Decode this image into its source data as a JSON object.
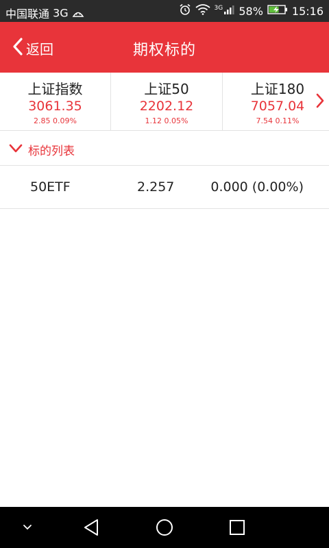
{
  "status_bar": {
    "carrier": "中国联通",
    "network": "3G",
    "signal_tag": "3G",
    "battery": "58%",
    "time": "15:16"
  },
  "header": {
    "back_label": "返回",
    "title": "期权标的"
  },
  "indices": [
    {
      "name": "上证指数",
      "price": "3061.35",
      "change": "2.85  0.09%"
    },
    {
      "name": "上证50",
      "price": "2202.12",
      "change": "1.12  0.05%"
    },
    {
      "name": "上证180",
      "price": "7057.04",
      "change": "7.54  0.11%"
    }
  ],
  "section": {
    "label": "标的列表"
  },
  "rows": [
    {
      "name": "50ETF",
      "price": "2.257",
      "change": "0.000 (0.00%)"
    }
  ],
  "colors": {
    "accent": "#e8343a",
    "status_bar": "#2b2b2b",
    "nav_bar": "#000000"
  },
  "icons": {
    "back": "chevron-left-icon",
    "more": "chevron-right-icon",
    "section": "chevron-down-icon",
    "nav": [
      "hide-keyboard-icon",
      "back-triangle-icon",
      "home-circle-icon",
      "recents-square-icon"
    ]
  }
}
